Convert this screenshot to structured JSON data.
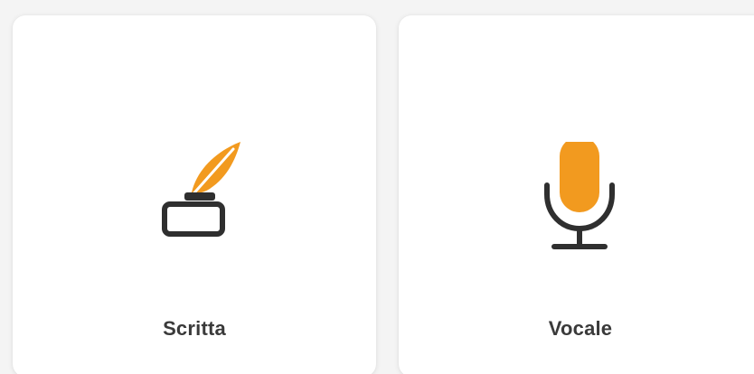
{
  "options": [
    {
      "label": "Scritta",
      "icon": "quill-inkwell-icon"
    },
    {
      "label": "Vocale",
      "icon": "microphone-icon"
    }
  ],
  "colors": {
    "accent": "#f29a1f",
    "icon_outline": "#2f2f2f",
    "label_text": "#3a3a3a",
    "card_bg": "#ffffff",
    "page_bg": "#f4f4f4"
  }
}
